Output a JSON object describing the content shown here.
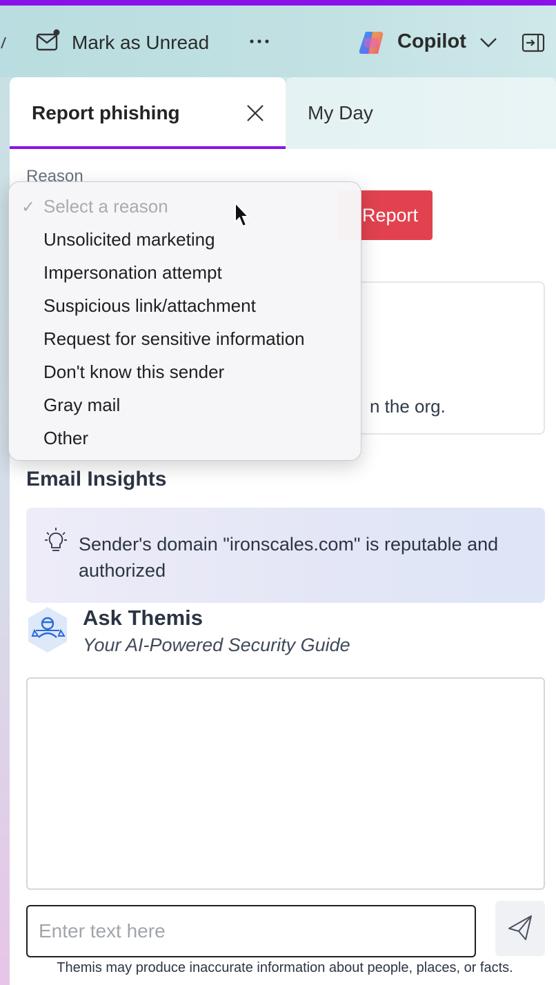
{
  "toolbar": {
    "mark_unread_label": "Mark as Unread",
    "copilot_label": "Copilot",
    "icons": [
      "chevron-left-icon",
      "mail-unread-icon",
      "more-icon",
      "copilot-logo",
      "chevron-down-icon",
      "open-pane-icon"
    ]
  },
  "tabs": [
    {
      "label": "Report phishing",
      "active": true
    },
    {
      "label": "My Day",
      "active": false
    }
  ],
  "report": {
    "reason_label": "Reason",
    "report_button": "Report",
    "dropdown": {
      "selected": "Select a reason",
      "options": [
        "Select a reason",
        "Unsolicited marketing",
        "Impersonation attempt",
        "Suspicious link/attachment",
        "Request for sensitive information",
        "Don't know this sender",
        "Gray mail",
        "Other"
      ]
    },
    "info_card_visible_text": "n the org."
  },
  "insights": {
    "title": "Email Insights",
    "items": [
      {
        "icon": "lightbulb-icon",
        "text": "Sender's domain \"ironscales.com\" is reputable and authorized"
      }
    ]
  },
  "themis": {
    "title": "Ask Themis",
    "subtitle": "Your AI-Powered Security Guide",
    "input_placeholder": "Enter text here",
    "disclaimer": "Themis may produce inaccurate information about people, places, or facts."
  },
  "colors": {
    "accent_purple": "#8a12e8",
    "report_red": "#e2424f",
    "toolbar_teal": "#c2e1e3"
  }
}
